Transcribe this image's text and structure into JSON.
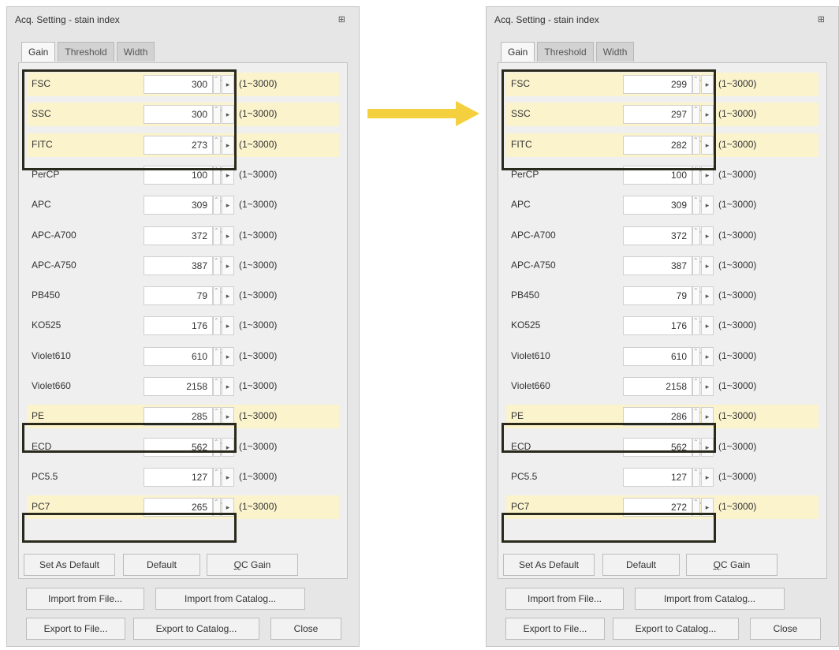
{
  "title": "Acq. Setting - stain index",
  "pin_glyph": "⊞",
  "tabs": [
    "Gain",
    "Threshold",
    "Width"
  ],
  "range_text": "(1~3000)",
  "spin_glyph": "⌃⌄",
  "step_glyph": "▸",
  "buttons": {
    "set_as_default": "Set As Default",
    "default": "Default",
    "qc_gain_prefix": "Q",
    "qc_gain_rest": "C Gain",
    "import_from_file": "Import from File...",
    "import_from_catalog": "Import from Catalog...",
    "export_to_file": "Export to File...",
    "export_to_catalog": "Export to Catalog...",
    "close": "Close"
  },
  "colors": {
    "highlight_fill": "#fbf3cc",
    "highlight_border": "#2a2a1c",
    "arrow": "#f4d03f"
  },
  "left": {
    "rows": [
      {
        "label": "FSC",
        "value": "300"
      },
      {
        "label": "SSC",
        "value": "300"
      },
      {
        "label": "FITC",
        "value": "273"
      },
      {
        "label": "PerCP",
        "value": "100"
      },
      {
        "label": "APC",
        "value": "309"
      },
      {
        "label": "APC-A700",
        "value": "372"
      },
      {
        "label": "APC-A750",
        "value": "387"
      },
      {
        "label": "PB450",
        "value": "79"
      },
      {
        "label": "KO525",
        "value": "176"
      },
      {
        "label": "Violet610",
        "value": "610"
      },
      {
        "label": "Violet660",
        "value": "2158"
      },
      {
        "label": "PE",
        "value": "285"
      },
      {
        "label": "ECD",
        "value": "562"
      },
      {
        "label": "PC5.5",
        "value": "127"
      },
      {
        "label": "PC7",
        "value": "265"
      }
    ]
  },
  "right": {
    "rows": [
      {
        "label": "FSC",
        "value": "299"
      },
      {
        "label": "SSC",
        "value": "297"
      },
      {
        "label": "FITC",
        "value": "282"
      },
      {
        "label": "PerCP",
        "value": "100"
      },
      {
        "label": "APC",
        "value": "309"
      },
      {
        "label": "APC-A700",
        "value": "372"
      },
      {
        "label": "APC-A750",
        "value": "387"
      },
      {
        "label": "PB450",
        "value": "79"
      },
      {
        "label": "KO525",
        "value": "176"
      },
      {
        "label": "Violet610",
        "value": "610"
      },
      {
        "label": "Violet660",
        "value": "2158"
      },
      {
        "label": "PE",
        "value": "286"
      },
      {
        "label": "ECD",
        "value": "562"
      },
      {
        "label": "PC5.5",
        "value": "127"
      },
      {
        "label": "PC7",
        "value": "272"
      }
    ]
  }
}
